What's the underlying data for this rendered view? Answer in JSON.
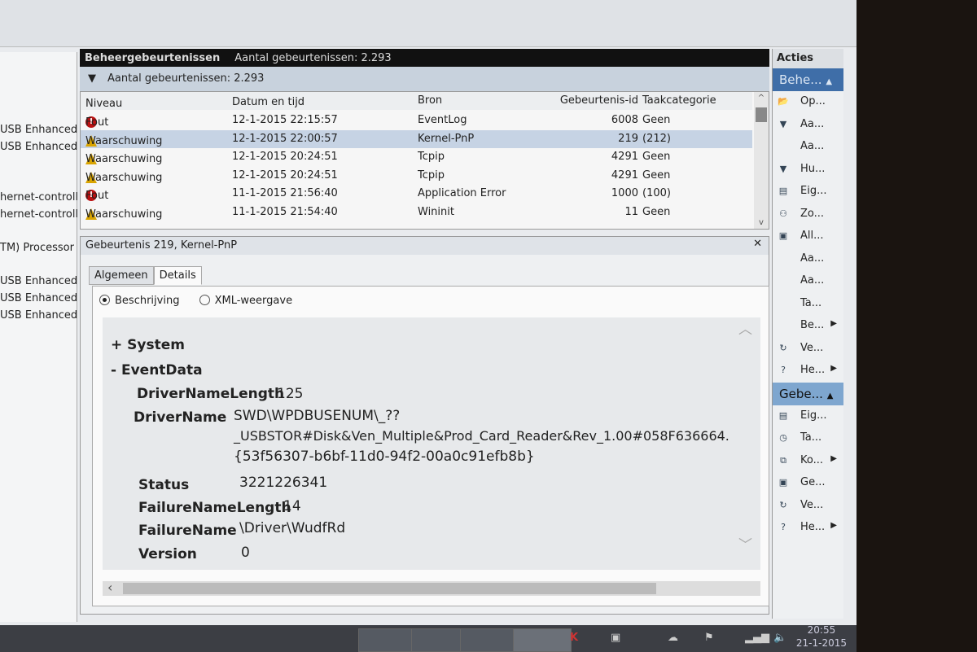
{
  "left_pane": [
    "USB Enhanced",
    "USB Enhanced",
    "hernet-controll",
    "hernet-controll",
    "TM) Processor",
    "USB Enhanced",
    "USB Enhanced",
    "USB Enhanced"
  ],
  "header": {
    "title": "Beheergebeurtenissen",
    "count": "Aantal gebeurtenissen: 2.293"
  },
  "filter_text": "Aantal gebeurtenissen: 2.293",
  "columns": [
    "Niveau",
    "Datum en tijd",
    "Bron",
    "Gebeurtenis-id",
    "Taakcategorie"
  ],
  "events": [
    {
      "level": "Fout",
      "type": "error",
      "date": "12-1-2015 22:15:57",
      "source": "EventLog",
      "id": "6008",
      "category": "Geen"
    },
    {
      "level": "Waarschuwing",
      "type": "warning",
      "date": "12-1-2015 22:00:57",
      "source": "Kernel-PnP",
      "id": "219",
      "category": "(212)",
      "selected": true
    },
    {
      "level": "Waarschuwing",
      "type": "warning",
      "date": "12-1-2015 20:24:51",
      "source": "Tcpip",
      "id": "4291",
      "category": "Geen"
    },
    {
      "level": "Waarschuwing",
      "type": "warning",
      "date": "12-1-2015 20:24:51",
      "source": "Tcpip",
      "id": "4291",
      "category": "Geen"
    },
    {
      "level": "Fout",
      "type": "error",
      "date": "11-1-2015 21:56:40",
      "source": "Application Error",
      "id": "1000",
      "category": "(100)"
    },
    {
      "level": "Waarschuwing",
      "type": "warning",
      "date": "11-1-2015 21:54:40",
      "source": "Wininit",
      "id": "11",
      "category": "Geen"
    }
  ],
  "detail": {
    "title": "Gebeurtenis 219, Kernel-PnP",
    "tabs": [
      "Algemeen",
      "Details"
    ],
    "radio_desc": "Beschrijving",
    "radio_xml": "XML-weergave",
    "system": "+ System",
    "eventdata": "- EventData",
    "fields": {
      "dnl_k": "DriverNameLength",
      "dnl_v": "125",
      "dn_k": "DriverName",
      "dn_v1": "SWD\\WPDBUSENUM\\_??",
      "dn_v2": "_USBSTOR#Disk&Ven_Multiple&Prod_Card_Reader&Rev_1.00#058F636664.",
      "dn_v3": "{53f56307-b6bf-11d0-94f2-00a0c91efb8b}",
      "st_k": "Status",
      "st_v": "3221226341",
      "fnl_k": "FailureNameLength",
      "fnl_v": "14",
      "fn_k": "FailureName",
      "fn_v": "\\Driver\\WudfRd",
      "ver_k": "Version",
      "ver_v": "0"
    }
  },
  "actions": {
    "title": "Acties",
    "group1": "Behe...",
    "items1": [
      {
        "icon": "folder",
        "l": "Op..."
      },
      {
        "icon": "filter",
        "l": "Aa..."
      },
      {
        "icon": "",
        "l": "Aa..."
      },
      {
        "icon": "filter",
        "l": "Hu..."
      },
      {
        "icon": "properties",
        "l": "Eig..."
      },
      {
        "icon": "find",
        "l": "Zo..."
      },
      {
        "icon": "save",
        "l": "All..."
      },
      {
        "icon": "",
        "l": "Aa..."
      },
      {
        "icon": "",
        "l": "Aa..."
      },
      {
        "icon": "",
        "l": "Ta..."
      },
      {
        "icon": "",
        "l": "Be...",
        "sub": true
      },
      {
        "icon": "refresh",
        "l": "Ve..."
      },
      {
        "icon": "help",
        "l": "He...",
        "sub": true
      }
    ],
    "group2": "Gebe...",
    "items2": [
      {
        "icon": "properties",
        "l": "Eig..."
      },
      {
        "icon": "task",
        "l": "Ta..."
      },
      {
        "icon": "copy",
        "l": "Ko...",
        "sub": true
      },
      {
        "icon": "save",
        "l": "Ge..."
      },
      {
        "icon": "refresh",
        "l": "Ve..."
      },
      {
        "icon": "help",
        "l": "He...",
        "sub": true
      }
    ]
  },
  "clock": {
    "time": "20:55",
    "date": "21-1-2015"
  }
}
